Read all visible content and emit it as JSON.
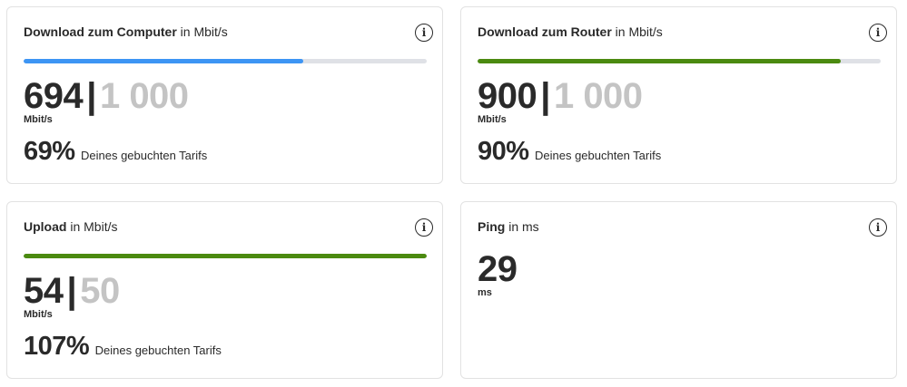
{
  "cards": {
    "download_computer": {
      "title": "Download zum Computer",
      "unit_label": "in Mbit/s",
      "value": "694",
      "separator": "|",
      "max": "1 000",
      "unit": "Mbit/s",
      "progress_fraction": 0.694,
      "bar_color": "#3d95f4",
      "percent": "69%",
      "percent_text": "Deines gebuchten Tarifs"
    },
    "download_router": {
      "title": "Download zum Router",
      "unit_label": "in Mbit/s",
      "value": "900",
      "separator": "|",
      "max": "1 000",
      "unit": "Mbit/s",
      "progress_fraction": 0.9,
      "bar_color": "#4b8a10",
      "percent": "90%",
      "percent_text": "Deines gebuchten Tarifs"
    },
    "upload": {
      "title": "Upload",
      "unit_label": "in Mbit/s",
      "value": "54",
      "separator": "|",
      "max": "50",
      "unit": "Mbit/s",
      "progress_fraction": 1.0,
      "bar_color": "#4b8a10",
      "percent": "107%",
      "percent_text": "Deines gebuchten Tarifs"
    },
    "ping": {
      "title": "Ping",
      "unit_label": "in ms",
      "value": "29",
      "unit": "ms"
    }
  },
  "icons": {
    "info": "info-circle-icon",
    "info_glyph": "i"
  },
  "colors": {
    "bar_track": "#dfe1e6",
    "max_value_gray": "#c4c4c4",
    "text": "#2a2a2a"
  }
}
